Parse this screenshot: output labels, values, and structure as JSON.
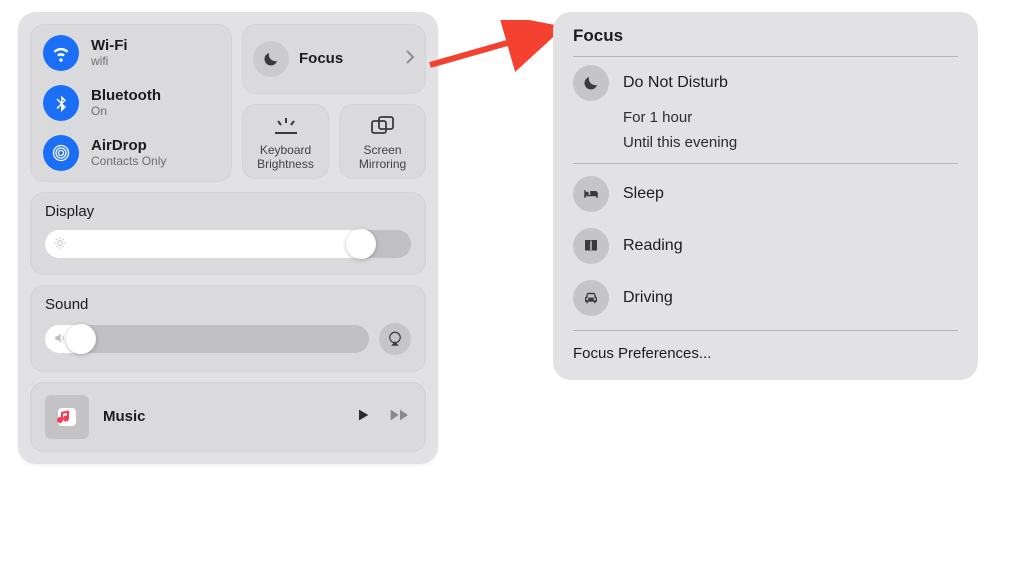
{
  "control_center": {
    "wifi": {
      "title": "Wi-Fi",
      "status": "wifi"
    },
    "bluetooth": {
      "title": "Bluetooth",
      "status": "On"
    },
    "airdrop": {
      "title": "AirDrop",
      "status": "Contacts Only"
    },
    "focus": {
      "label": "Focus"
    },
    "tiles": {
      "keyboard_brightness": "Keyboard Brightness",
      "screen_mirroring": "Screen Mirroring"
    },
    "display": {
      "label": "Display"
    },
    "sound": {
      "label": "Sound"
    },
    "music": {
      "label": "Music"
    }
  },
  "focus_panel": {
    "title": "Focus",
    "dnd": {
      "label": "Do Not Disturb",
      "opt1": "For 1 hour",
      "opt2": "Until this evening"
    },
    "modes": {
      "sleep": "Sleep",
      "reading": "Reading",
      "driving": "Driving"
    },
    "prefs": "Focus Preferences..."
  }
}
